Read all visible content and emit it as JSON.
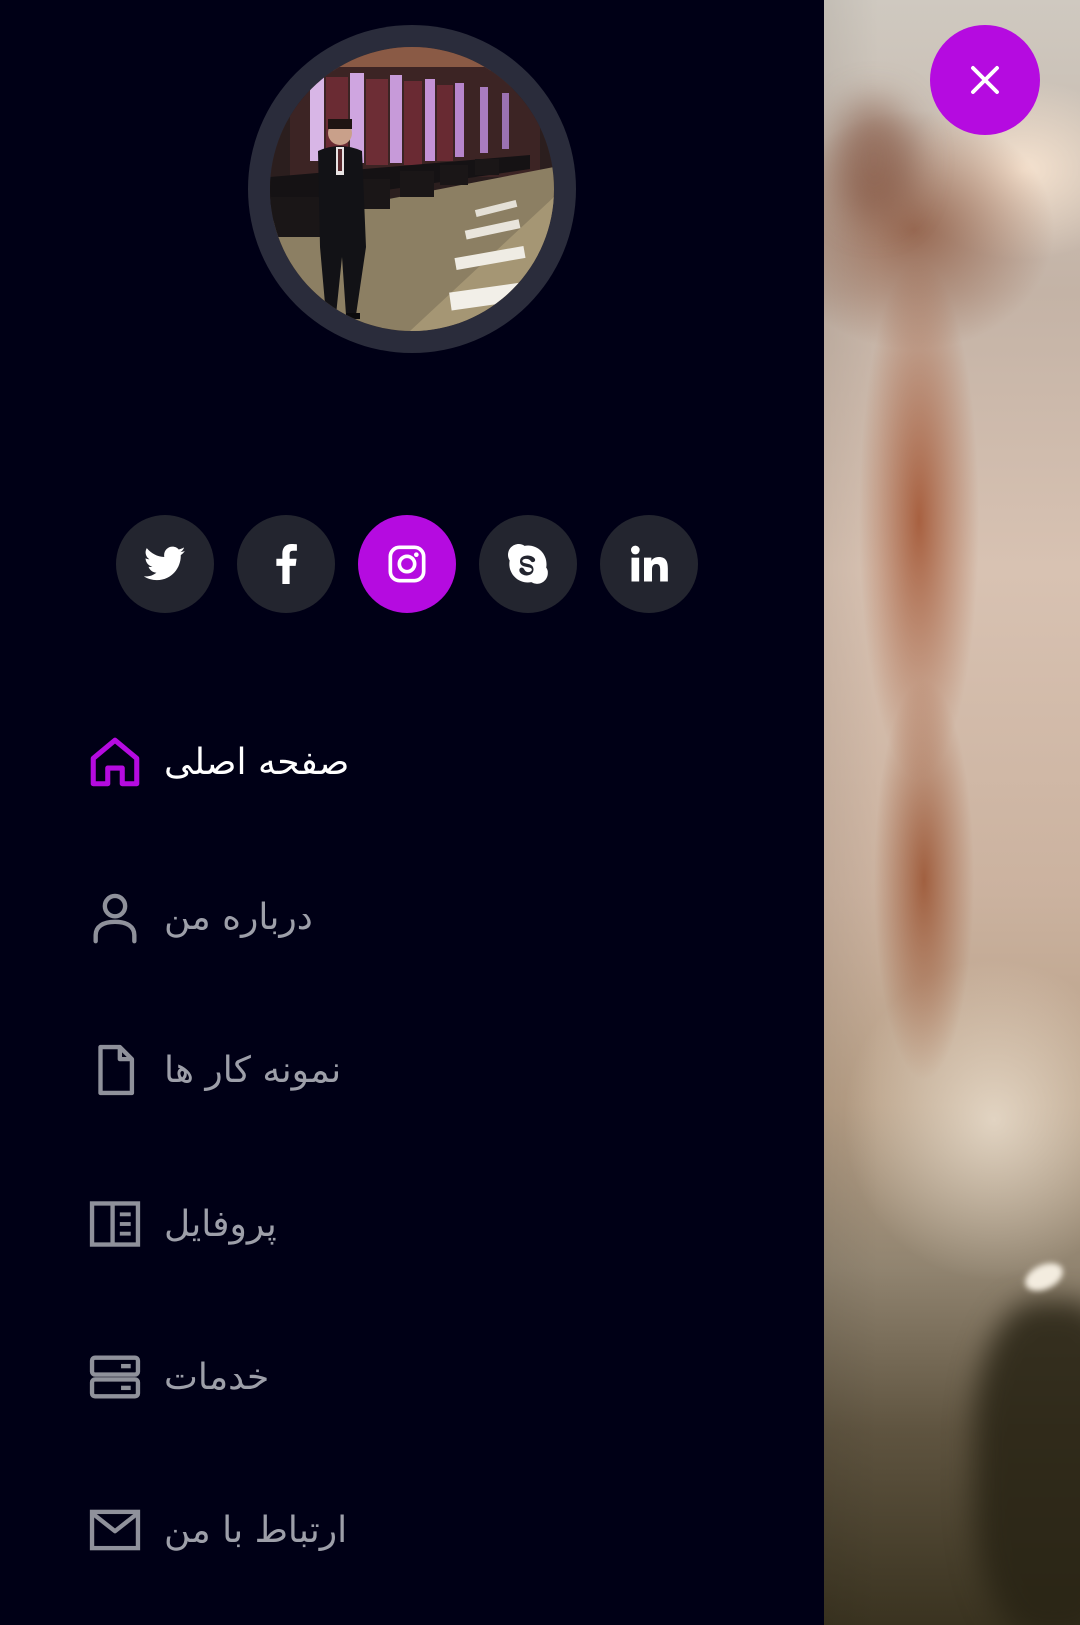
{
  "colors": {
    "drawer_background": "#000016",
    "accent": "#b50be0",
    "social_button_background": "#23252f",
    "avatar_ring": "#2a2c3b",
    "nav_text_inactive": "#9d9fa9",
    "nav_text_active": "#ffffff",
    "nav_icon_inactive": "#8f919b"
  },
  "profile": {
    "avatar_icon": "profile-photo"
  },
  "social": [
    {
      "name": "twitter",
      "icon": "twitter-icon",
      "active": false
    },
    {
      "name": "facebook",
      "icon": "facebook-icon",
      "active": false
    },
    {
      "name": "instagram",
      "icon": "instagram-icon",
      "active": true
    },
    {
      "name": "skype",
      "icon": "skype-icon",
      "active": false
    },
    {
      "name": "linkedin",
      "icon": "linkedin-icon",
      "active": false
    }
  ],
  "nav": {
    "items": [
      {
        "label": "صفحه اصلی",
        "icon": "home-icon",
        "active": true
      },
      {
        "label": "درباره من",
        "icon": "user-icon",
        "active": false
      },
      {
        "label": "نمونه کار ها",
        "icon": "document-icon",
        "active": false
      },
      {
        "label": "پروفایل",
        "icon": "book-open-icon",
        "active": false
      },
      {
        "label": "خدمات",
        "icon": "server-icon",
        "active": false
      },
      {
        "label": "ارتباط با من",
        "icon": "mail-icon",
        "active": false
      }
    ]
  },
  "close_button": {
    "icon": "close-icon"
  }
}
